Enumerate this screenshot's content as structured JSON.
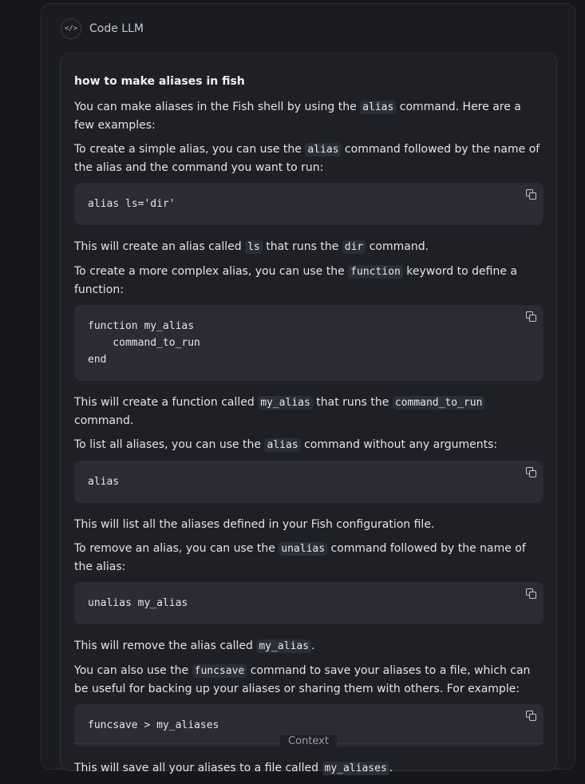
{
  "bot": {
    "icon": "code-icon",
    "icon_glyph": "</>",
    "name": "Code LLM"
  },
  "question": "how to make aliases in fish",
  "blocks": [
    {
      "type": "p",
      "parts": [
        [
          "t",
          "You can make aliases in the Fish shell by using the "
        ],
        [
          "c",
          "alias"
        ],
        [
          "t",
          " command. Here are a few examples:"
        ]
      ]
    },
    {
      "type": "p",
      "parts": [
        [
          "t",
          "To create a simple alias, you can use the "
        ],
        [
          "c",
          "alias"
        ],
        [
          "t",
          " command followed by the name of the alias and the command you want to run:"
        ]
      ]
    },
    {
      "type": "code",
      "code": "alias ls='dir'"
    },
    {
      "type": "p",
      "parts": [
        [
          "t",
          "This will create an alias called "
        ],
        [
          "c",
          "ls"
        ],
        [
          "t",
          " that runs the "
        ],
        [
          "c",
          "dir"
        ],
        [
          "t",
          " command."
        ]
      ]
    },
    {
      "type": "p",
      "parts": [
        [
          "t",
          "To create a more complex alias, you can use the "
        ],
        [
          "c",
          "function"
        ],
        [
          "t",
          " keyword to define a function:"
        ]
      ]
    },
    {
      "type": "code",
      "code": "function my_alias\n    command_to_run\nend"
    },
    {
      "type": "p",
      "parts": [
        [
          "t",
          "This will create a function called "
        ],
        [
          "c",
          "my_alias"
        ],
        [
          "t",
          " that runs the "
        ],
        [
          "c",
          "command_to_run"
        ],
        [
          "t",
          " command."
        ]
      ]
    },
    {
      "type": "p",
      "parts": [
        [
          "t",
          "To list all aliases, you can use the "
        ],
        [
          "c",
          "alias"
        ],
        [
          "t",
          " command without any arguments:"
        ]
      ]
    },
    {
      "type": "code",
      "code": "alias"
    },
    {
      "type": "p",
      "parts": [
        [
          "t",
          "This will list all the aliases defined in your Fish configuration file."
        ]
      ]
    },
    {
      "type": "p",
      "parts": [
        [
          "t",
          "To remove an alias, you can use the "
        ],
        [
          "c",
          "unalias"
        ],
        [
          "t",
          " command followed by the name of the alias:"
        ]
      ]
    },
    {
      "type": "code",
      "code": "unalias my_alias"
    },
    {
      "type": "p",
      "parts": [
        [
          "t",
          "This will remove the alias called "
        ],
        [
          "c",
          "my_alias"
        ],
        [
          "t",
          "."
        ]
      ]
    },
    {
      "type": "p",
      "parts": [
        [
          "t",
          "You can also use the "
        ],
        [
          "c",
          "funcsave"
        ],
        [
          "t",
          " command to save your aliases to a file, which can be useful for backing up your aliases or sharing them with others. For example:"
        ]
      ]
    },
    {
      "type": "code",
      "code": "funcsave > my_aliases"
    },
    {
      "type": "p",
      "parts": [
        [
          "t",
          "This will save all your aliases to a file called "
        ],
        [
          "c",
          "my_aliases"
        ],
        [
          "t",
          "."
        ]
      ]
    }
  ],
  "copy_icon": "copy-icon",
  "context_label": "Context"
}
